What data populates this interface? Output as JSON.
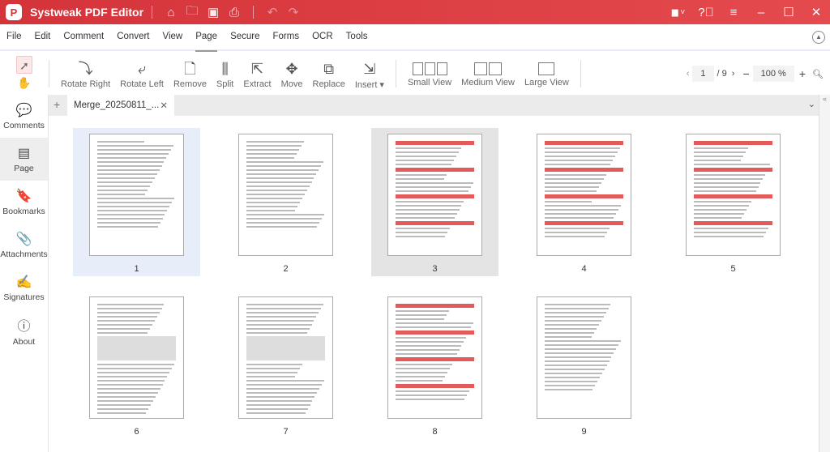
{
  "app": {
    "title": "Systweak PDF Editor"
  },
  "menu": [
    "File",
    "Edit",
    "Comment",
    "Convert",
    "View",
    "Page",
    "Secure",
    "Forms",
    "OCR",
    "Tools"
  ],
  "active_menu": "Page",
  "tools": [
    {
      "label": "Rotate Right",
      "icon": "⤵"
    },
    {
      "label": "Rotate Left",
      "icon": "⤶"
    },
    {
      "label": "Remove",
      "icon": "🗋"
    },
    {
      "label": "Split",
      "icon": "⫼"
    },
    {
      "label": "Extract",
      "icon": "⇱"
    },
    {
      "label": "Move",
      "icon": "✥"
    },
    {
      "label": "Replace",
      "icon": "⧉"
    },
    {
      "label": "Insert ▾",
      "icon": "⇲"
    }
  ],
  "views": [
    "Small View",
    "Medium View",
    "Large View"
  ],
  "navigation": {
    "current_page": "1",
    "total": "/ 9",
    "zoom": "100 %"
  },
  "tab": {
    "name": "Merge_20250811_..."
  },
  "sidebar": [
    {
      "label": "Comments",
      "icon": "💬"
    },
    {
      "label": "Page",
      "icon": "▤"
    },
    {
      "label": "Bookmarks",
      "icon": "🔖"
    },
    {
      "label": "Attachments",
      "icon": "📎"
    },
    {
      "label": "Signatures",
      "icon": "✍"
    },
    {
      "label": "About",
      "icon": "ⓘ"
    }
  ],
  "pages": [
    "1",
    "2",
    "3",
    "4",
    "5",
    "6",
    "7",
    "8",
    "9"
  ],
  "selected_page": "1",
  "colors": {
    "accent": "#d93b3e"
  }
}
